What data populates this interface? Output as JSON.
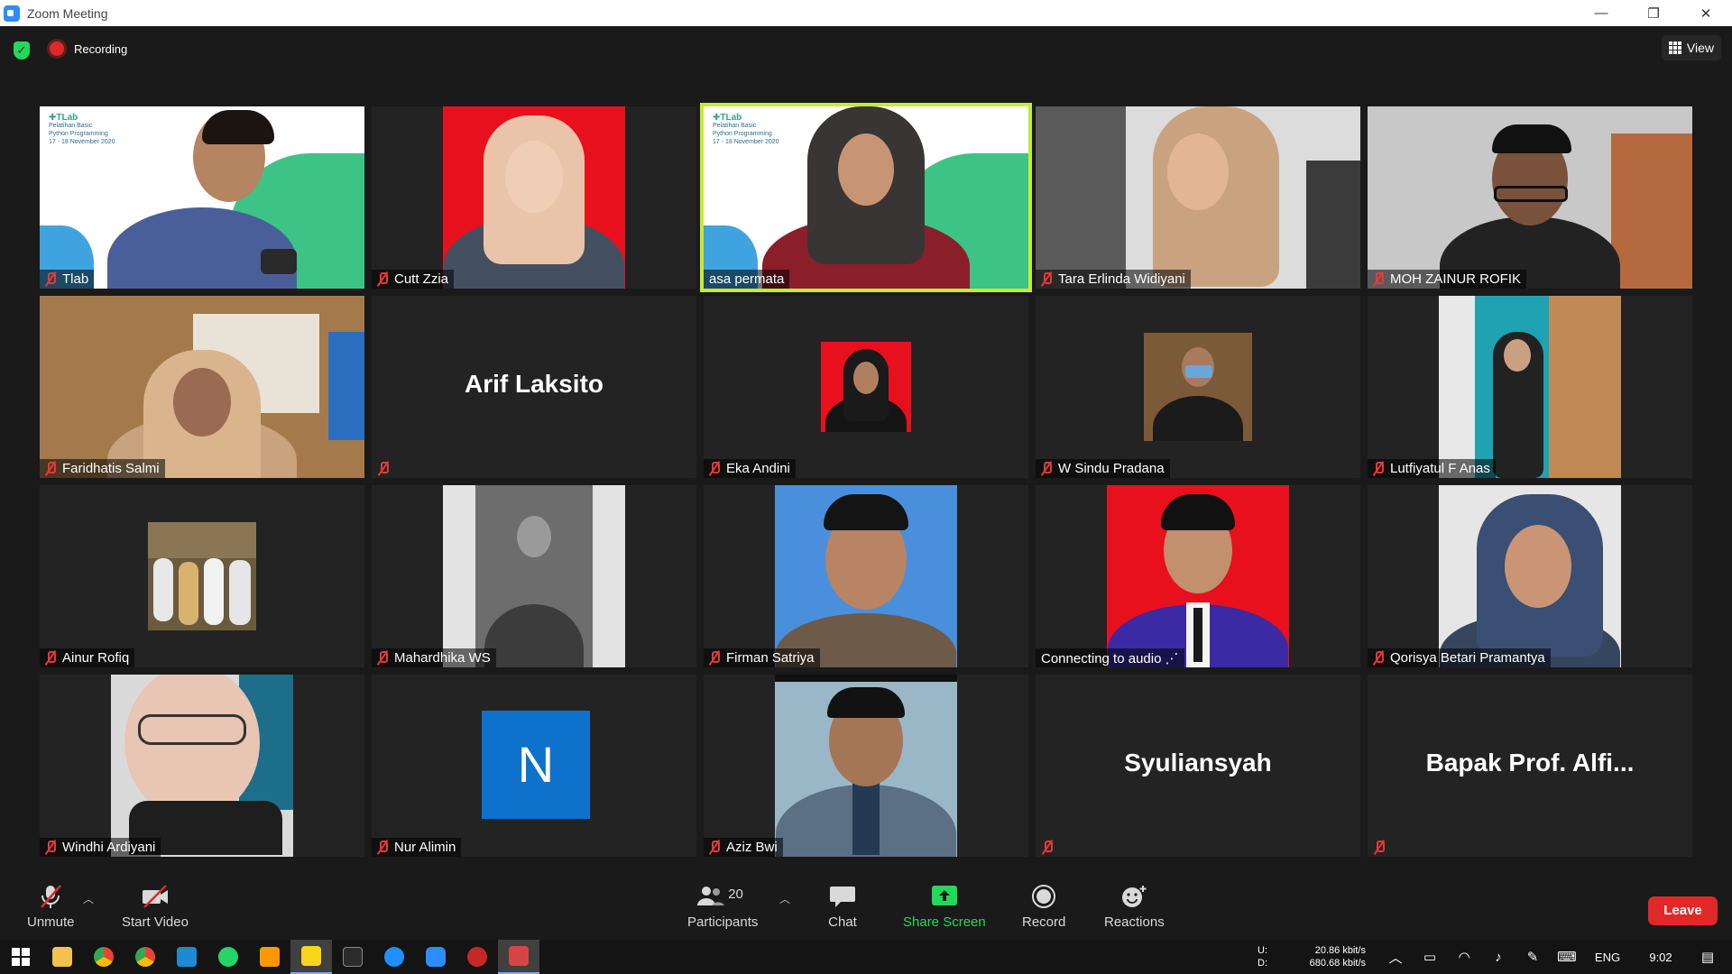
{
  "window": {
    "title": "Zoom Meeting",
    "controls": [
      "—",
      "❐",
      "✕"
    ]
  },
  "topbar": {
    "recording_label": "Recording",
    "view_label": "View"
  },
  "participants_tiles": [
    {
      "name": "Tlab",
      "muted": true
    },
    {
      "name": "Cutt Zzia",
      "muted": true
    },
    {
      "name": "asa permata",
      "muted": false,
      "speaking": true
    },
    {
      "name": "Tara Erlinda Widiyani",
      "muted": true
    },
    {
      "name": "MOH ZAINUR ROFIK",
      "muted": true
    },
    {
      "name": "Faridhatis Salmi",
      "muted": true
    },
    {
      "name": "",
      "display_name": "Arif Laksito",
      "muted": true
    },
    {
      "name": "Eka Andini",
      "muted": true
    },
    {
      "name": "W Sindu Pradana",
      "muted": true
    },
    {
      "name": "Lutfiyatul F Anas",
      "muted": true
    },
    {
      "name": "Ainur Rofiq",
      "muted": true
    },
    {
      "name": "Mahardhika WS",
      "muted": true
    },
    {
      "name": "Firman Satriya",
      "muted": true
    },
    {
      "name": "Connecting to audio ⋰",
      "muted": false
    },
    {
      "name": "Qorisya Betari Pramantya",
      "muted": true
    },
    {
      "name": "Windhi Ardiyani",
      "muted": true
    },
    {
      "name": "Nur Alimin",
      "muted": true,
      "avatar_letter": "N"
    },
    {
      "name": "Aziz Bwi",
      "muted": true
    },
    {
      "name": "",
      "display_name": "Syuliansyah",
      "muted": true
    },
    {
      "name": "",
      "display_name": "Bapak Prof. Alfi...",
      "muted": true
    }
  ],
  "slide_banner": {
    "brand": "✚TLab",
    "line1": "Pelatihan Basic",
    "line2": "Python Programming",
    "date": "17 - 18 November 2020"
  },
  "toolbar": {
    "unmute": "Unmute",
    "start_video": "Start Video",
    "participants": "Participants",
    "participants_count": "20",
    "chat": "Chat",
    "share_screen": "Share Screen",
    "record": "Record",
    "reactions": "Reactions",
    "leave": "Leave"
  },
  "taskbar": {
    "net_up_label": "U:",
    "net_up": "20.86 kbit/s",
    "net_down_label": "D:",
    "net_down": "680.68 kbit/s",
    "language": "ENG",
    "time": "9:02"
  },
  "colors": {
    "zoom_blue": "#2d8cff",
    "speaking_border": "#c5eb35",
    "mute_red": "#e53935",
    "share_green": "#23d959",
    "leave_red": "#e02828"
  }
}
